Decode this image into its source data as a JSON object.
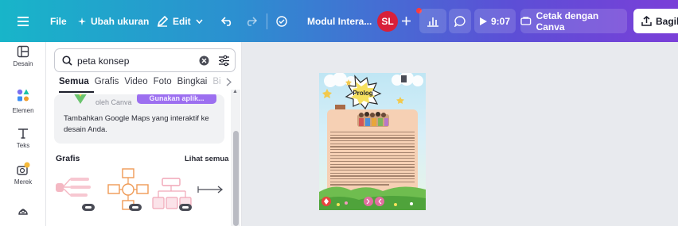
{
  "toolbar": {
    "file_label": "File",
    "resize_label": "Ubah ukuran",
    "edit_label": "Edit",
    "doc_title": "Modul Intera...",
    "avatar_initials": "SL",
    "timer": "9:07",
    "print_label": "Cetak dengan Canva",
    "share_label": "Bagika",
    "menu_icon": "hamburger-menu-icon",
    "accent_start": "#18b5c9",
    "accent_end": "#7a3fd8"
  },
  "rail": {
    "items": [
      {
        "label": "Desain",
        "icon": "layout-icon"
      },
      {
        "label": "Elemen",
        "icon": "elements-icon"
      },
      {
        "label": "Teks",
        "icon": "text-icon"
      },
      {
        "label": "Merek",
        "icon": "brand-icon"
      },
      {
        "label": "",
        "icon": "apps-icon"
      }
    ]
  },
  "panel": {
    "search_value": "peta konsep",
    "tabs": [
      "Semua",
      "Grafis",
      "Video",
      "Foto",
      "Bingkai",
      "Bi"
    ],
    "card": {
      "by_line": "oleh Canva",
      "button_label": "Gunakan aplik...",
      "description": "Tambahkan Google Maps yang interaktif ke desain Anda."
    },
    "grafis_title": "Grafis",
    "see_all": "Lihat semua"
  },
  "page_preview": {
    "title": "Prolog"
  }
}
